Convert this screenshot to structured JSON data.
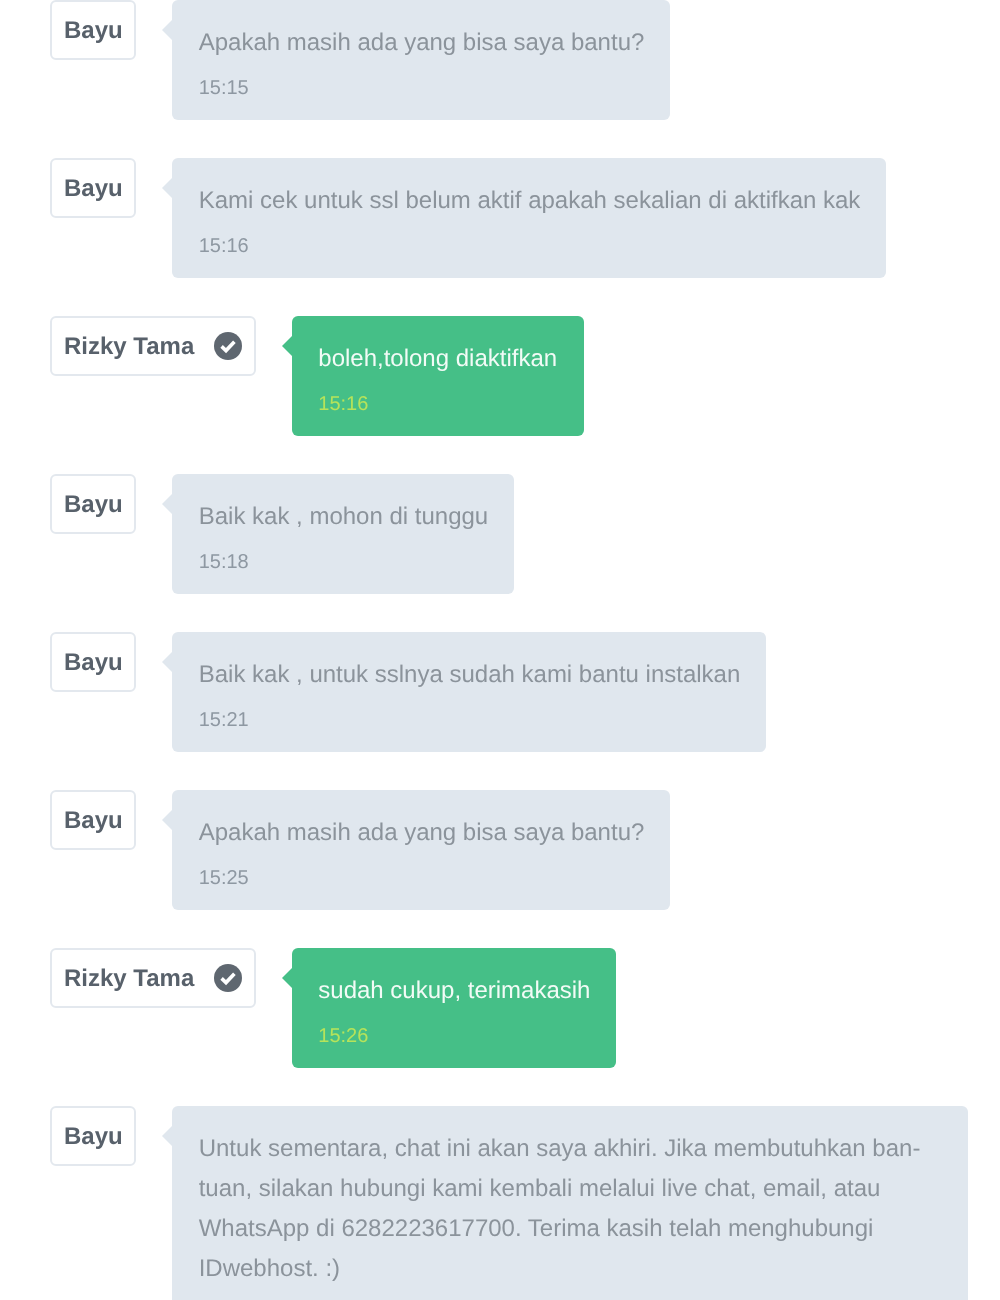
{
  "messages": [
    {
      "sender": "Bayu",
      "verified": false,
      "kind": "agent",
      "text": "Apakah masih ada yang bisa saya bantu?",
      "time": "15:15"
    },
    {
      "sender": "Bayu",
      "verified": false,
      "kind": "agent",
      "text": "Kami cek untuk ssl belum aktif apakah sekalian di aktifkan kak",
      "time": "15:16"
    },
    {
      "sender": "Rizky Tama",
      "verified": true,
      "kind": "customer",
      "text": "boleh,tolong diaktifkan",
      "time": "15:16"
    },
    {
      "sender": "Bayu",
      "verified": false,
      "kind": "agent",
      "text": "Baik kak , mohon di tunggu",
      "time": "15:18"
    },
    {
      "sender": "Bayu",
      "verified": false,
      "kind": "agent",
      "text": "Baik kak , untuk sslnya sudah kami bantu instalkan",
      "time": "15:21"
    },
    {
      "sender": "Bayu",
      "verified": false,
      "kind": "agent",
      "text": "Apakah masih ada yang bisa saya bantu?",
      "time": "15:25"
    },
    {
      "sender": "Rizky Tama",
      "verified": true,
      "kind": "customer",
      "text": "sudah cukup, terimakasih",
      "time": "15:26"
    },
    {
      "sender": "Bayu",
      "verified": false,
      "kind": "agent",
      "text": "Untuk sementara, chat ini akan saya akhiri. Jika membutuhkan ban-tuan, silakan hubungi kami kembali melalui live chat, email, atau WhatsApp di 6282223617700. Terima kasih telah menghubungi IDwebhost. :)"
    }
  ]
}
